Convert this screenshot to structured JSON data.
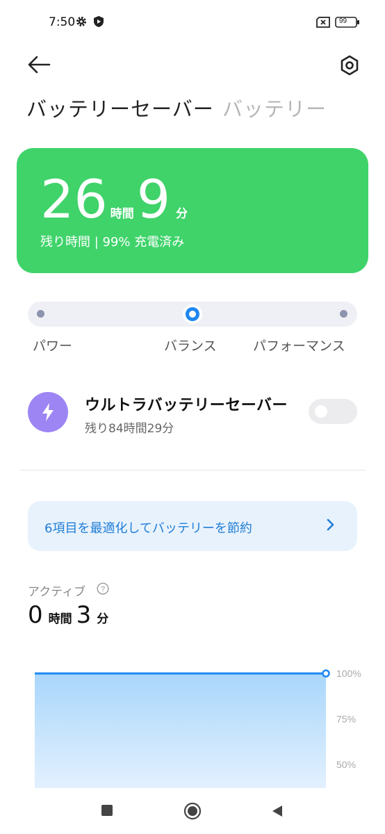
{
  "status": {
    "time": "7:50",
    "battery": "99"
  },
  "header": {
    "tab_active": "バッテリーセーバー",
    "tab_inactive": "バッテリー"
  },
  "card": {
    "hours": "26",
    "hours_unit": "時間",
    "minutes": "9",
    "minutes_unit": "分",
    "subtitle": "残り時間 | 99% 充電済み",
    "color": "#3fd36a"
  },
  "mode_slider": {
    "options": [
      "パワー",
      "バランス",
      "パフォーマンス"
    ],
    "selected": "バランス"
  },
  "ultra_saver": {
    "title": "ウルトラバッテリーセーバー",
    "subtitle": "残り84時間29分",
    "enabled": false
  },
  "optimize": {
    "text": "6項目を最適化してバッテリーを節約"
  },
  "active": {
    "label": "アクティブ",
    "hours": "0",
    "hours_unit": "時間",
    "minutes": "3",
    "minutes_unit": "分"
  },
  "chart_data": {
    "type": "area",
    "y_ticks": [
      "100%",
      "75%",
      "50%"
    ],
    "values": [
      100,
      100
    ],
    "ylim": [
      0,
      100
    ],
    "color": "#1e88f0"
  }
}
